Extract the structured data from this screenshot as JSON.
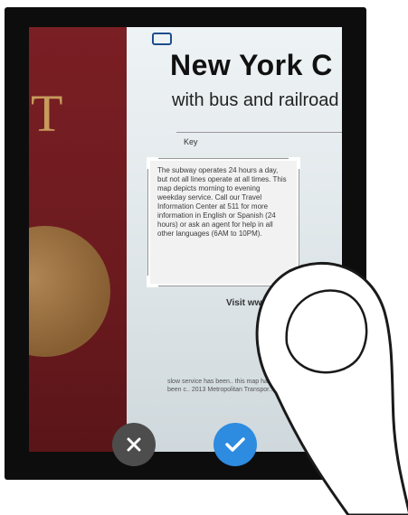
{
  "camera": {
    "scanned_page": {
      "title": "New York C",
      "subtitle": "with bus and railroad",
      "key_label": "Key",
      "visit_text": "Visit www.",
      "small_text": "slow service has been.. this map has been c.. 2013 Metropolitan Transpor.."
    },
    "ocr_selection": {
      "text": "The subway operates 24 hours a day, but not all lines operate at all times. This map depicts morning to evening weekday service. Call our Travel Information Center at 511 for more information in English or Spanish (24 hours) or ask an agent for help in all other languages (6AM to 10PM)."
    }
  },
  "actions": {
    "cancel_icon": "close-icon",
    "confirm_icon": "check-icon"
  },
  "colors": {
    "confirm_accent": "#2d8be0",
    "cancel_bg": "#4d4d4d",
    "passport": "#7a1f24"
  }
}
